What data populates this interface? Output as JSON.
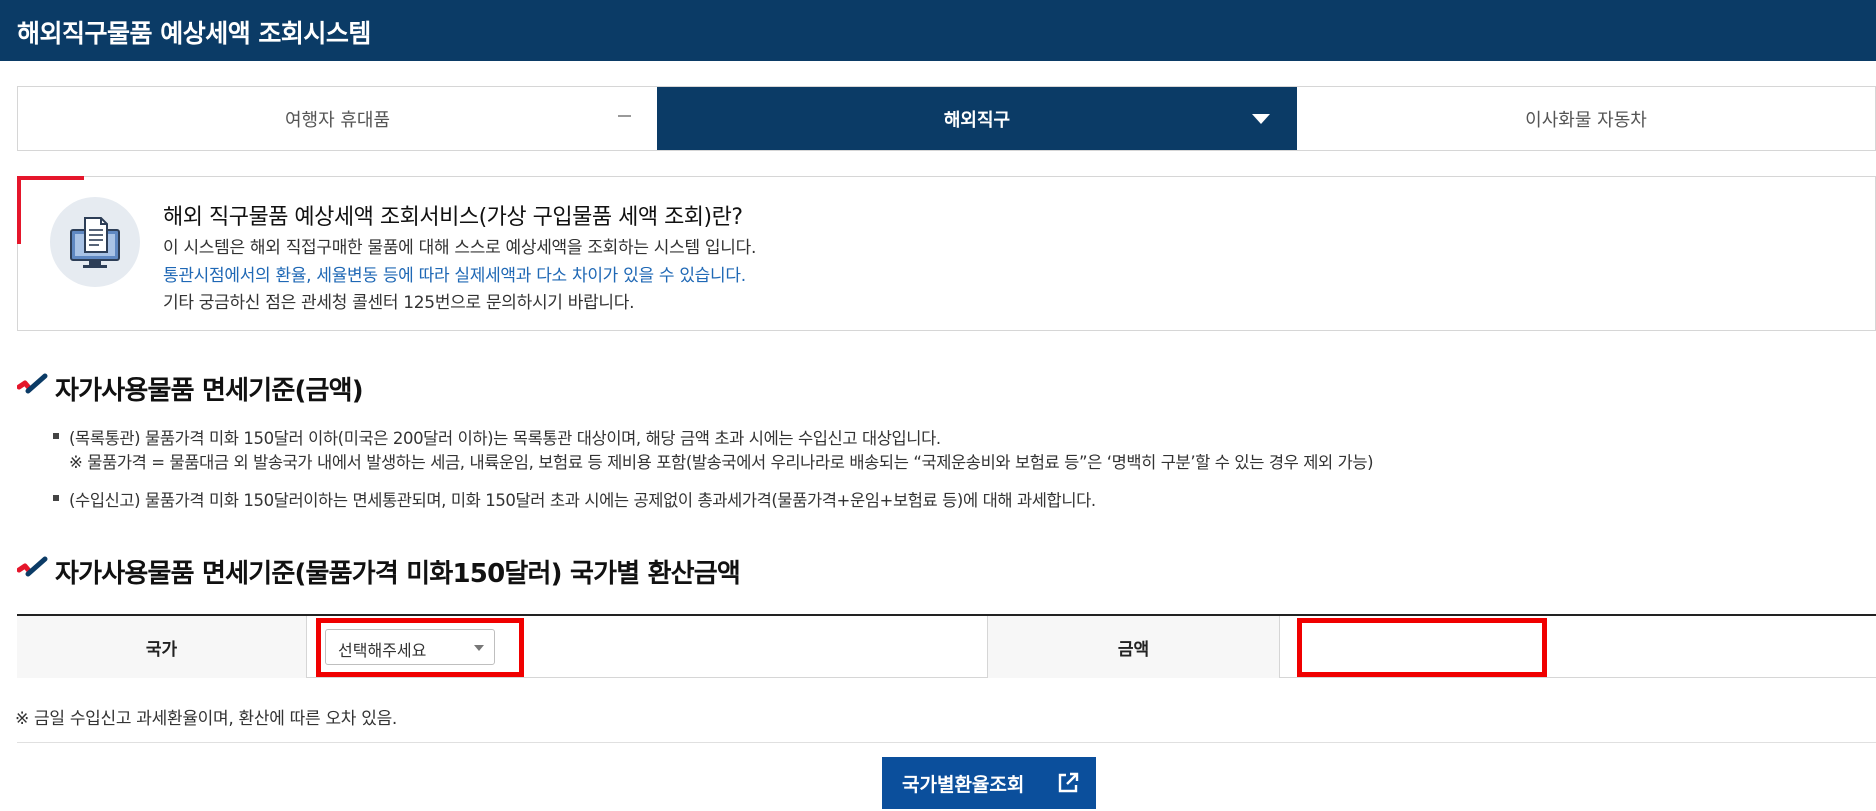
{
  "header": {
    "title": "해외직구물품 예상세액 조회시스템"
  },
  "tabs": [
    {
      "label": "여행자 휴대품"
    },
    {
      "label": "해외직구"
    },
    {
      "label": "이사화물 자동차"
    }
  ],
  "intro": {
    "icon": "computer-document-icon",
    "title": "해외 직구물품 예상세액 조회서비스(가상 구입물품 세액 조회)란?",
    "line1": "이 시스템은 해외 직접구매한 물품에 대해 스스로 예상세액을 조회하는 시스템 입니다.",
    "line2": "통관시점에서의 환율, 세율변동 등에 따라 실제세액과 다소 차이가 있을 수 있습니다.",
    "line3": "기타 궁금하신 점은 관세청 콜센터 125번으로 문의하시기 바랍니다."
  },
  "section1": {
    "title": "자가사용물품 면세기준(금액)",
    "bullet1": "(목록통관) 물품가격 미화 150달러 이하(미국은 200달러 이하)는 목록통관 대상이며, 해당 금액 초과 시에는 수입신고 대상입니다.",
    "bullet1_note": "※ 물품가격 = 물품대금 외 발송국가 내에서 발생하는 세금, 내륙운임, 보험료 등 제비용 포함(발송국에서 우리나라로 배송되는 “국제운송비와 보험료 등”은 ‘명백히 구분’할 수 있는 경우 제외 가능)",
    "bullet2": "(수입신고) 물품가격 미화 150달러이하는 면세통관되며, 미화 150달러 초과 시에는 공제없이 총과세가격(물품가격+운임+보험료 등)에 대해 과세합니다."
  },
  "section2": {
    "title": "자가사용물품 면세기준(물품가격 미화150달러) 국가별 환산금액",
    "country_label": "국가",
    "country_select": "선택해주세요",
    "amount_label": "금액",
    "amount_value": "",
    "note": "※  금일 수입신고 과세환율이며, 환산에 따른 오차 있음.",
    "button_label": "국가별환율조회"
  },
  "colors": {
    "header_bg": "#0b3b66",
    "active_tab": "#0b3b66",
    "accent_red": "#e5162b",
    "highlight_red": "#f00000",
    "link_blue": "#1f68b5",
    "button_blue": "#0b4f9c"
  }
}
